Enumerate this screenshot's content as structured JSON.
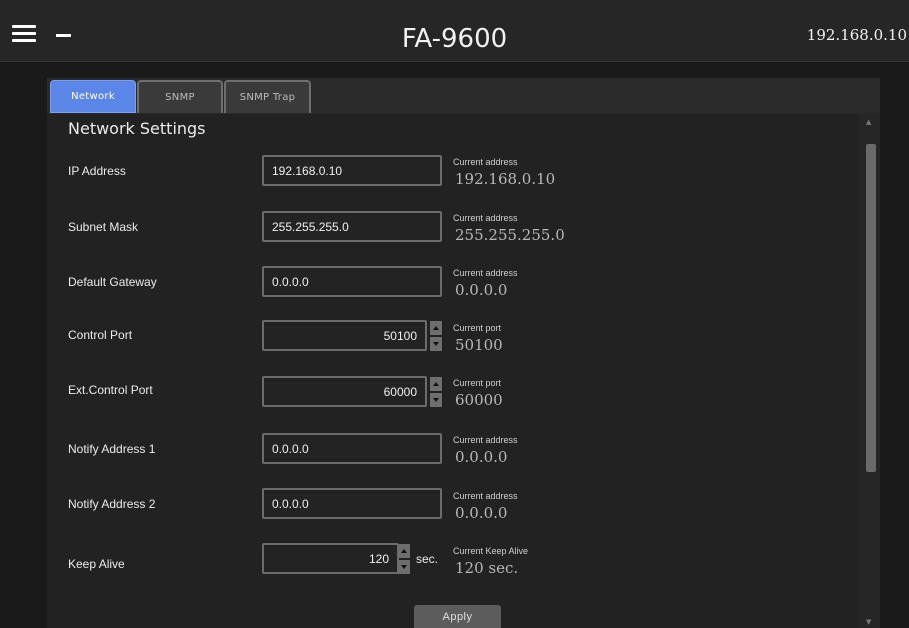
{
  "header": {
    "title": "FA-9600",
    "ip_address": "192.168.0.10"
  },
  "tabs": [
    {
      "label": "Network",
      "active": true
    },
    {
      "label": "SNMP",
      "active": false
    },
    {
      "label": "SNMP Trap",
      "active": false
    }
  ],
  "section_title": "Network Settings",
  "fields": {
    "ip_address": {
      "label": "IP Address",
      "value": "192.168.0.10",
      "current_caption": "Current address",
      "current_value": "192.168.0.10"
    },
    "subnet_mask": {
      "label": "Subnet Mask",
      "value": "255.255.255.0",
      "current_caption": "Current address",
      "current_value": "255.255.255.0"
    },
    "default_gateway": {
      "label": "Default Gateway",
      "value": "0.0.0.0",
      "current_caption": "Current address",
      "current_value": "0.0.0.0"
    },
    "control_port": {
      "label": "Control Port",
      "value": "50100",
      "current_caption": "Current port",
      "current_value": "50100"
    },
    "ext_control_port": {
      "label": "Ext.Control Port",
      "value": "60000",
      "current_caption": "Current port",
      "current_value": "60000"
    },
    "notify_address_1": {
      "label": "Notify Address 1",
      "value": "0.0.0.0",
      "current_caption": "Current address",
      "current_value": "0.0.0.0"
    },
    "notify_address_2": {
      "label": "Notify Address 2",
      "value": "0.0.0.0",
      "current_caption": "Current address",
      "current_value": "0.0.0.0"
    },
    "keep_alive": {
      "label": "Keep Alive",
      "value": "120",
      "unit": "sec.",
      "current_caption": "Current Keep Alive",
      "current_value": "120 sec."
    }
  },
  "apply_label": "Apply",
  "colors": {
    "active_tab": "#5a86e8",
    "background": "#1a1a1a",
    "panel": "#222222"
  },
  "icons": {
    "menu": "hamburger-icon",
    "minimize": "minus-icon",
    "spin_up": "triangle-up-icon",
    "spin_down": "triangle-down-icon"
  }
}
